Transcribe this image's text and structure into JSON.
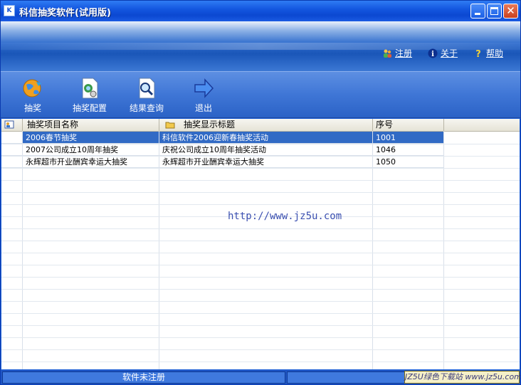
{
  "window": {
    "title": "科信抽奖软件(试用版)"
  },
  "top_links": {
    "register": "注册",
    "about": "关于",
    "help": "帮助"
  },
  "toolbar": {
    "draw": "抽奖",
    "config": "抽奖配置",
    "query": "结果查询",
    "exit": "退出"
  },
  "table": {
    "headers": [
      "抽奖项目名称",
      "抽奖显示标题",
      "序号"
    ],
    "rows": [
      {
        "name": "2006春节抽奖",
        "title": "科信软件2006迎新春抽奖活动",
        "no": "1001",
        "selected": true
      },
      {
        "name": "2007公司成立10周年抽奖",
        "title": "庆祝公司成立10周年抽奖活动",
        "no": "1046",
        "selected": false
      },
      {
        "name": "永辉超市开业酬宾幸运大抽奖",
        "title": "永辉超市开业酬宾幸运大抽奖",
        "no": "1050",
        "selected": false
      }
    ]
  },
  "watermark": "http://www.jz5u.com",
  "status": {
    "left": "软件未注册",
    "badge": "JZ5U绿色下载站 www.jz5u.com"
  },
  "colors": {
    "titlebar": "#1457e0",
    "selection": "#316ac5",
    "toolbar": "#3f76d6"
  }
}
